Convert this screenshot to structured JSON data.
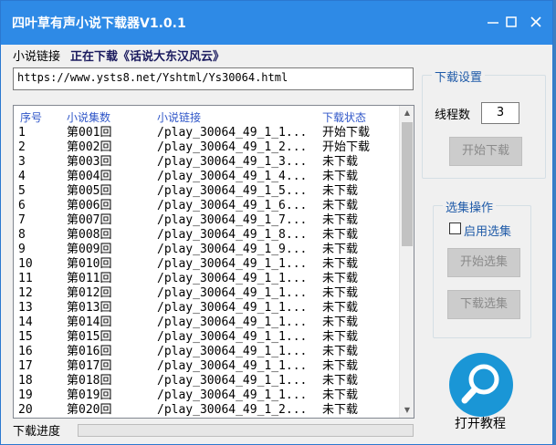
{
  "window": {
    "title": "四叶草有声小说下载器V1.0.1",
    "minimize_icon": "minimize-icon",
    "maximize_icon": "maximize-icon",
    "close_icon": "close-icon"
  },
  "top": {
    "link_label": "小说链接",
    "downloading_status": "正在下载《话说大东汉风云》",
    "url": "https://www.ysts8.net/Yshtml/Ys30064.html"
  },
  "table": {
    "headers": [
      "序号",
      "小说集数",
      "小说链接",
      "下载状态"
    ],
    "rows": [
      [
        "1",
        "第001回",
        "/play_30064_49_1_1...",
        "开始下载"
      ],
      [
        "2",
        "第002回",
        "/play_30064_49_1_2...",
        "开始下载"
      ],
      [
        "3",
        "第003回",
        "/play_30064_49_1_3...",
        "未下载"
      ],
      [
        "4",
        "第004回",
        "/play_30064_49_1_4...",
        "未下载"
      ],
      [
        "5",
        "第005回",
        "/play_30064_49_1_5...",
        "未下载"
      ],
      [
        "6",
        "第006回",
        "/play_30064_49_1_6...",
        "未下载"
      ],
      [
        "7",
        "第007回",
        "/play_30064_49_1_7...",
        "未下载"
      ],
      [
        "8",
        "第008回",
        "/play_30064_49_1_8...",
        "未下载"
      ],
      [
        "9",
        "第009回",
        "/play_30064_49_1_9...",
        "未下载"
      ],
      [
        "10",
        "第010回",
        "/play_30064_49_1_1...",
        "未下载"
      ],
      [
        "11",
        "第011回",
        "/play_30064_49_1_1...",
        "未下载"
      ],
      [
        "12",
        "第012回",
        "/play_30064_49_1_1...",
        "未下载"
      ],
      [
        "13",
        "第013回",
        "/play_30064_49_1_1...",
        "未下载"
      ],
      [
        "14",
        "第014回",
        "/play_30064_49_1_1...",
        "未下载"
      ],
      [
        "15",
        "第015回",
        "/play_30064_49_1_1...",
        "未下载"
      ],
      [
        "16",
        "第016回",
        "/play_30064_49_1_1...",
        "未下载"
      ],
      [
        "17",
        "第017回",
        "/play_30064_49_1_1...",
        "未下载"
      ],
      [
        "18",
        "第018回",
        "/play_30064_49_1_1...",
        "未下载"
      ],
      [
        "19",
        "第019回",
        "/play_30064_49_1_1...",
        "未下载"
      ],
      [
        "20",
        "第020回",
        "/play_30064_49_1_2...",
        "未下载"
      ]
    ]
  },
  "progress": {
    "label": "下载进度",
    "fraction": 0
  },
  "download_settings": {
    "group_title": "下载设置",
    "threads_label": "线程数",
    "threads_value": "3",
    "start_button": "开始下载"
  },
  "selection": {
    "group_title": "选集操作",
    "enable_label": "启用选集",
    "start_select_button": "开始选集",
    "download_select_button": "下载选集"
  },
  "tutorial": {
    "label": "打开教程",
    "icon": "search-icon"
  },
  "colors": {
    "titlebar": "#2e8ae6",
    "accent_blue": "#1e5aa8",
    "header_text": "#2f56c8",
    "progress_fill": "#06b025",
    "tutorial_icon": "#1a96d6"
  }
}
